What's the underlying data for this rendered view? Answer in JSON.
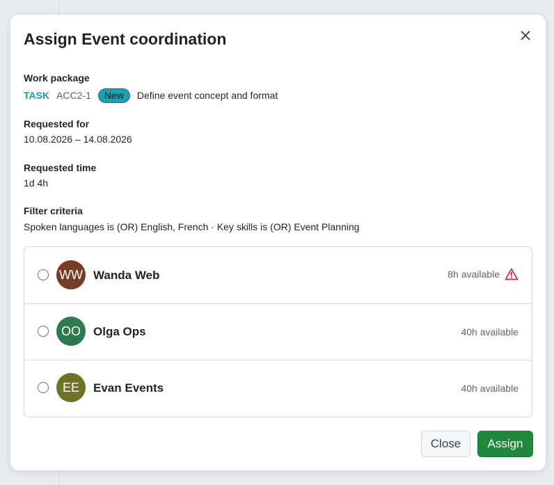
{
  "modal": {
    "title": "Assign Event coordination",
    "close_icon": "close-icon"
  },
  "work_package": {
    "label": "Work package",
    "type": "TASK",
    "id": "ACC2-1",
    "status": "New",
    "subject": "Define event concept and format"
  },
  "requested_for": {
    "label": "Requested for",
    "value": "10.08.2026 – 14.08.2026"
  },
  "requested_time": {
    "label": "Requested time",
    "value": "1d 4h"
  },
  "filter_criteria": {
    "label": "Filter criteria",
    "value": "Spoken languages is (OR) English, French · Key skills is (OR) Event Planning"
  },
  "candidates": [
    {
      "initials": "WW",
      "name": "Wanda Web",
      "availability": "8h available",
      "warning": true,
      "avatar_color": "#7a3b26"
    },
    {
      "initials": "OO",
      "name": "Olga Ops",
      "availability": "40h available",
      "warning": false,
      "avatar_color": "#2e7a4f"
    },
    {
      "initials": "EE",
      "name": "Evan Events",
      "availability": "40h available",
      "warning": false,
      "avatar_color": "#6f7326"
    }
  ],
  "buttons": {
    "close": "Close",
    "assign": "Assign"
  },
  "colors": {
    "accent_teal": "#1a9bad",
    "primary_green": "#1f883d",
    "warning_red": "#cf222e"
  }
}
